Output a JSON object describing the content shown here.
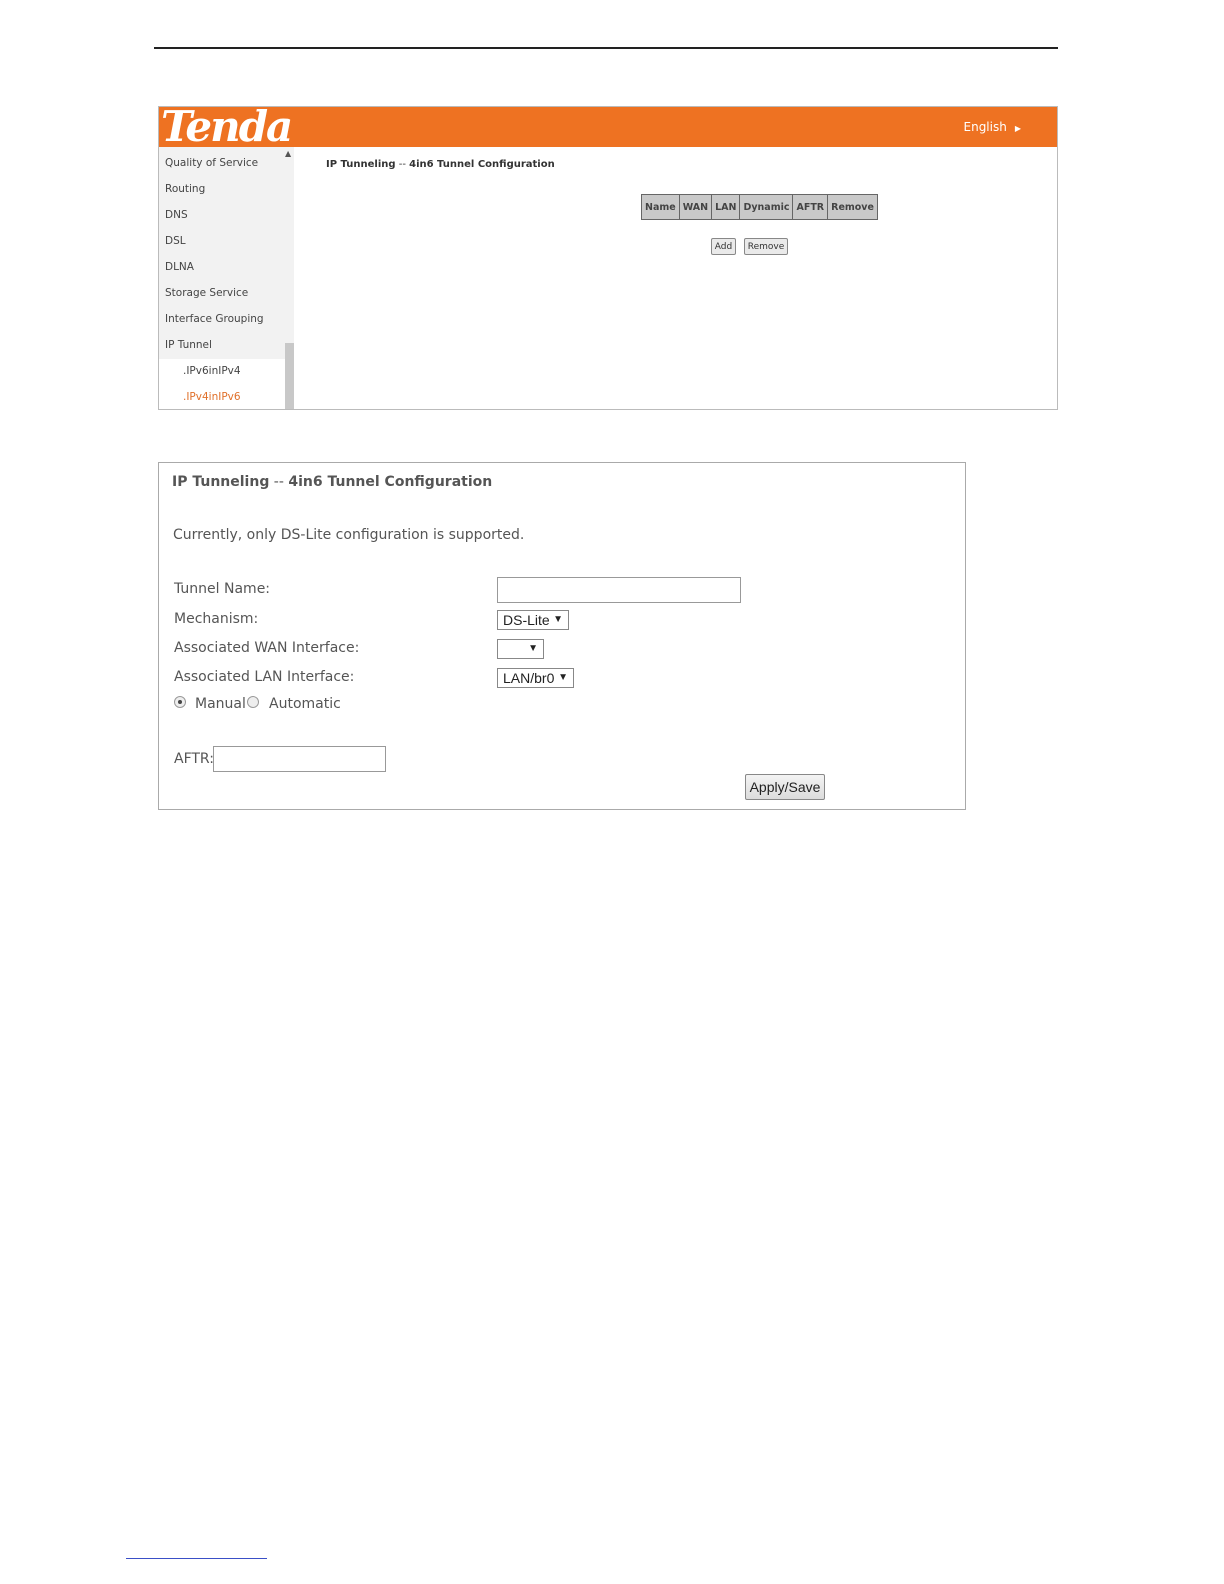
{
  "screenshot1": {
    "logo_text": "Tenda",
    "language": "English",
    "sidebar": {
      "items": [
        {
          "label": "Quality of Service"
        },
        {
          "label": "Routing"
        },
        {
          "label": "DNS"
        },
        {
          "label": "DSL"
        },
        {
          "label": "DLNA"
        },
        {
          "label": "Storage Service"
        },
        {
          "label": "Interface Grouping"
        },
        {
          "label": "IP Tunnel"
        },
        {
          "label": ".IPv6inIPv4"
        },
        {
          "label": ".IPv4inIPv6"
        }
      ]
    },
    "title_main": "IP Tunneling",
    "title_sep": " -- ",
    "title_sub": "4in6 Tunnel Configuration",
    "table_headers": [
      "Name",
      "WAN",
      "LAN",
      "Dynamic",
      "AFTR",
      "Remove"
    ],
    "add_label": "Add",
    "remove_label": "Remove"
  },
  "screenshot2": {
    "title_main": "IP Tunneling",
    "title_sep": " -- ",
    "title_sub": "4in6 Tunnel Configuration",
    "note": "Currently, only DS-Lite configuration is supported.",
    "tunnel_name_label": "Tunnel Name:",
    "tunnel_name_value": "",
    "mechanism_label": "Mechanism:",
    "mechanism_value": "DS-Lite",
    "wan_label": "Associated WAN Interface:",
    "wan_value": "",
    "lan_label": "Associated LAN Interface:",
    "lan_value": "LAN/br0",
    "radio_manual": "Manual",
    "radio_automatic": "Automatic",
    "aftr_label": "AFTR:",
    "aftr_value": "",
    "apply_label": "Apply/Save"
  }
}
